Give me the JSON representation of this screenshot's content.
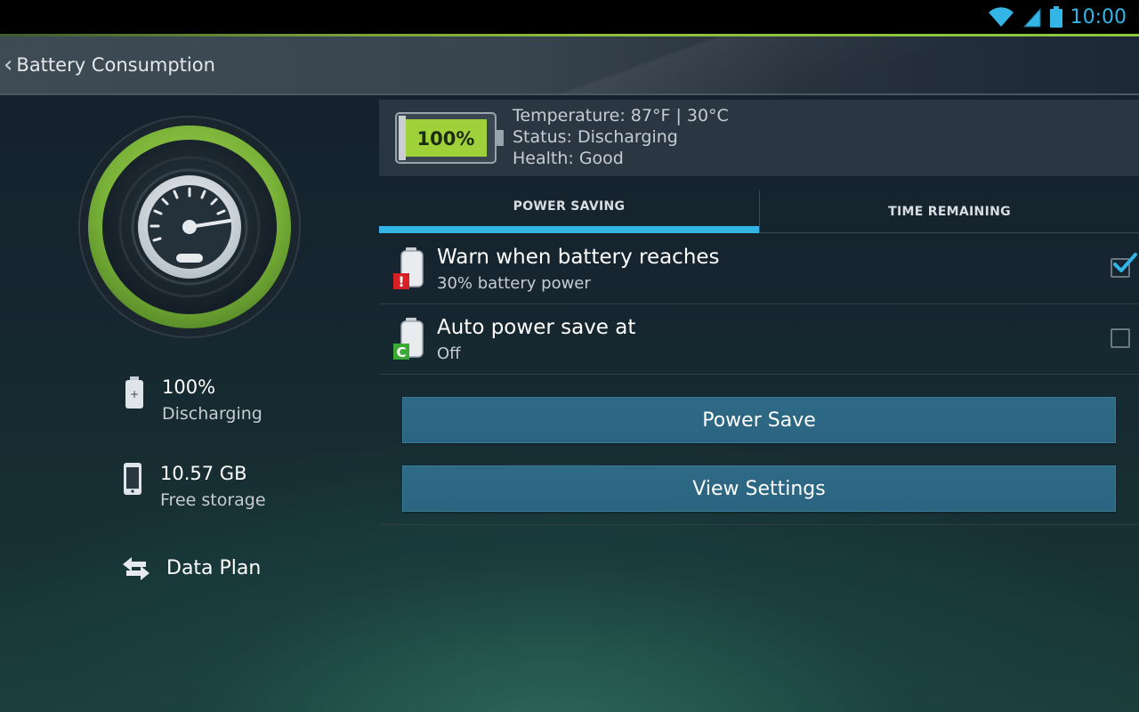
{
  "status_bar": {
    "time": "10:00",
    "icons": [
      "wifi-icon",
      "signal-icon",
      "battery-icon"
    ]
  },
  "action_bar": {
    "title": "Battery Consumption",
    "back_icon": "chevron-left-icon"
  },
  "left_panel": {
    "gauge_icon": "speedometer-icon",
    "stats": [
      {
        "value": "100%",
        "label": "Discharging",
        "icon": "battery-icon"
      },
      {
        "value": "10.57 GB",
        "label": "Free storage",
        "icon": "phone-icon"
      },
      {
        "value": "Data Plan",
        "icon": "transfer-arrows-icon"
      }
    ]
  },
  "battery_info": {
    "level_text": "100%",
    "level": 1.0,
    "temperature": "Temperature: 87°F | 30°C",
    "status": "Status: Discharging",
    "health": "Health: Good"
  },
  "tabs": [
    {
      "label": "POWER SAVING",
      "selected": true
    },
    {
      "label": "TIME REMAINING",
      "selected": false
    }
  ],
  "settings": [
    {
      "title": "Warn when battery reaches",
      "subtitle": "30% battery power",
      "checked": true,
      "icon": "battery-warning-icon"
    },
    {
      "title": "Auto power save at",
      "subtitle": "Off",
      "checked": false,
      "icon": "battery-powersave-icon"
    }
  ],
  "buttons": {
    "power_save": "Power Save",
    "view_settings": "View Settings"
  },
  "colors": {
    "accent_blue": "#33b5e5",
    "accent_green": "#8cc63f",
    "button_blue": "#2c6684",
    "warning_red": "#d71f26",
    "save_green": "#3aa935"
  }
}
